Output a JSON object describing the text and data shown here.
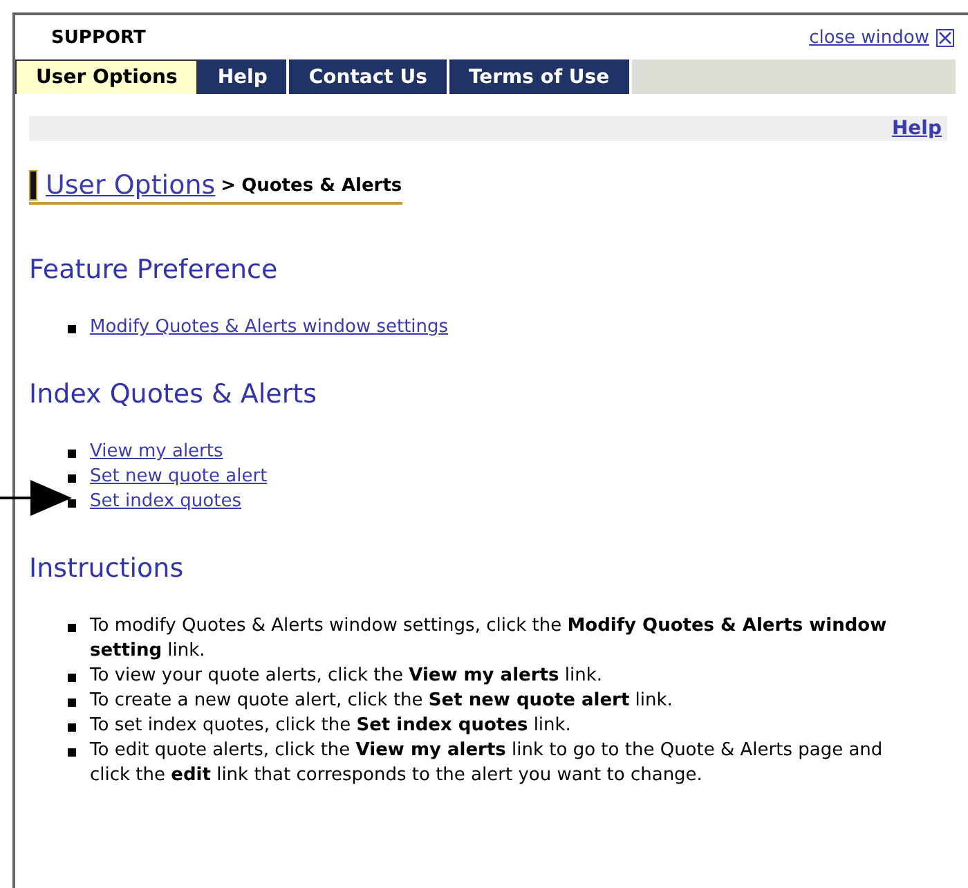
{
  "window": {
    "title": "SUPPORT",
    "close_link": "close window"
  },
  "tabs": [
    {
      "label": "User Options",
      "selected": true
    },
    {
      "label": "Help",
      "selected": false
    },
    {
      "label": "Contact Us",
      "selected": false
    },
    {
      "label": "Terms of Use",
      "selected": false
    }
  ],
  "help_link": "Help",
  "breadcrumb": {
    "parent": "User Options",
    "separator": ">",
    "current": "Quotes & Alerts"
  },
  "sections": [
    {
      "heading": "Feature Preference",
      "kind": "links",
      "items": [
        "Modify Quotes & Alerts window settings"
      ]
    },
    {
      "heading": "Index Quotes & Alerts",
      "kind": "links",
      "items": [
        "View my alerts",
        "Set new quote alert",
        "Set index quotes"
      ]
    },
    {
      "heading": "Instructions",
      "kind": "text",
      "items": [
        "To modify Quotes & Alerts window settings, click the **Modify Quotes & Alerts window setting** link.",
        "To view your quote alerts, click the **View my alerts** link.",
        "To create a new quote alert, click the **Set new quote alert** link.",
        "To set index quotes, click the **Set index quotes** link.",
        "To edit quote alerts, click the **View my alerts** link to go to the Quote & Alerts page and click the **edit** link that corresponds to the alert you want to change."
      ]
    }
  ]
}
